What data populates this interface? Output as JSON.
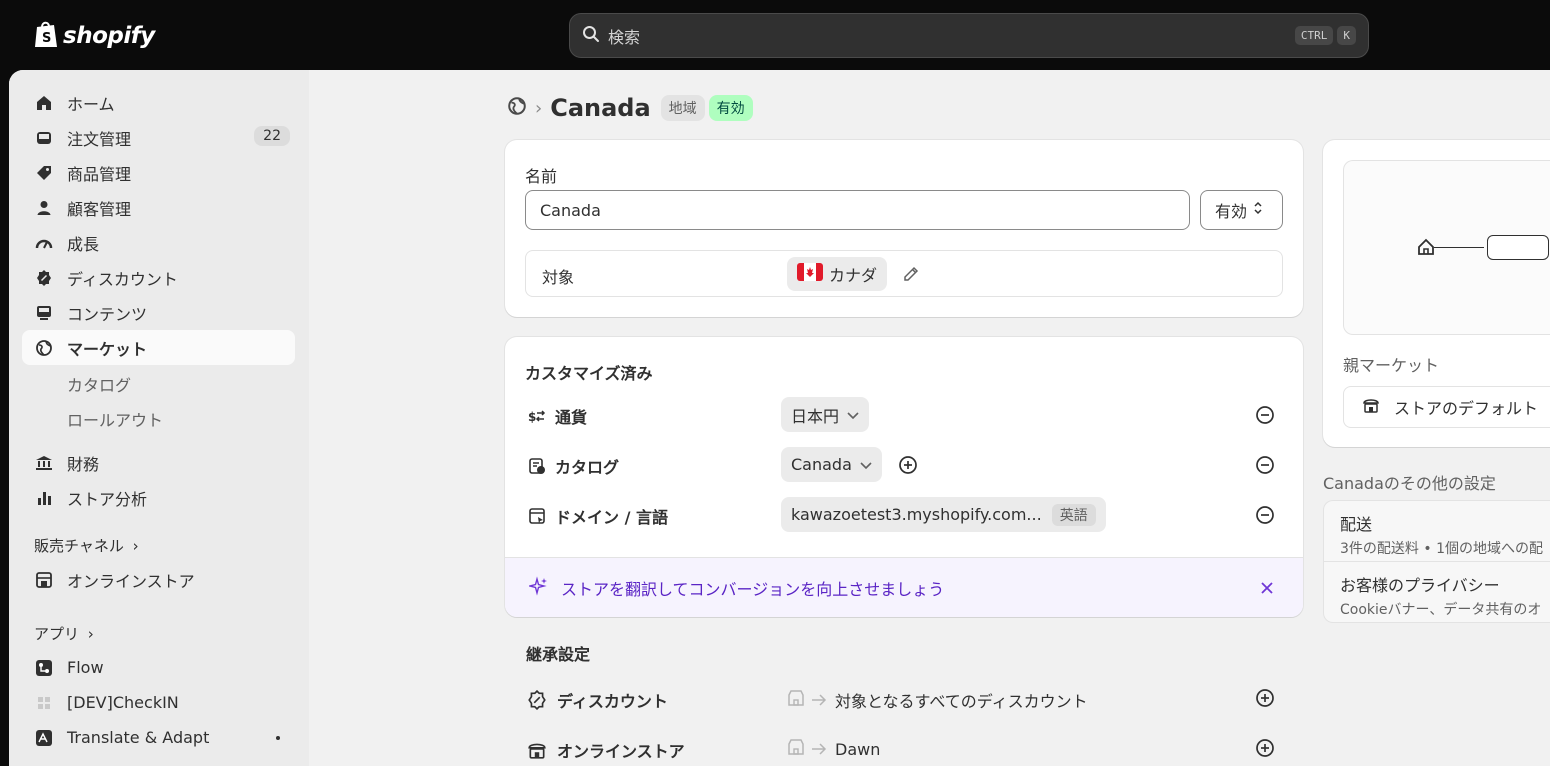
{
  "topbar": {
    "logo_text": "shopify",
    "search_placeholder": "検索",
    "kbd_ctrl": "CTRL",
    "kbd_k": "K"
  },
  "sidebar": {
    "items": [
      {
        "label": "ホーム",
        "icon": "home-icon"
      },
      {
        "label": "注文管理",
        "icon": "inbox-icon",
        "badge": "22"
      },
      {
        "label": "商品管理",
        "icon": "tag-icon"
      },
      {
        "label": "顧客管理",
        "icon": "person-icon"
      },
      {
        "label": "成長",
        "icon": "gauge-icon"
      },
      {
        "label": "ディスカウント",
        "icon": "discount-icon"
      },
      {
        "label": "コンテンツ",
        "icon": "content-icon"
      },
      {
        "label": "マーケット",
        "icon": "globe-icon"
      }
    ],
    "market_sub": [
      "カタログ",
      "ロールアウト"
    ],
    "items2": [
      {
        "label": "財務",
        "icon": "bank-icon"
      },
      {
        "label": "ストア分析",
        "icon": "bar-chart-icon"
      }
    ],
    "sales_channels_label": "販売チャネル",
    "online_store": "オンラインストア",
    "apps_label": "アプリ",
    "apps": [
      "Flow",
      "[DEV]CheckIN",
      "Translate & Adapt"
    ]
  },
  "page": {
    "title": "Canada",
    "badge_region": "地域",
    "badge_active": "有効"
  },
  "name_card": {
    "name_label": "名前",
    "name_value": "Canada",
    "status_select": "有効",
    "target_label": "対象",
    "target_country": "カナダ"
  },
  "custom_card": {
    "heading": "カスタマイズ済み",
    "rows": [
      {
        "label": "通貨",
        "value": "日本円"
      },
      {
        "label": "カタログ",
        "value": "Canada"
      },
      {
        "label": "ドメイン / 言語",
        "value": "kawazoetest3.myshopify.com...",
        "tag": "英語"
      }
    ],
    "banner": "ストアを翻訳してコンバージョンを向上させましょう"
  },
  "inherited": {
    "heading": "継承設定",
    "rows": [
      {
        "label": "ディスカウント",
        "value": "対象となるすべてのディスカウント"
      },
      {
        "label": "オンラインストア",
        "value": "Dawn"
      }
    ]
  },
  "right": {
    "parent_market_label": "親マーケット",
    "parent_market_value": "ストアのデフォルト",
    "other_settings_title": "Canadaのその他の設定",
    "settings": [
      {
        "title": "配送",
        "desc": "3件の配送料 • 1個の地域への配"
      },
      {
        "title": "お客様のプライバシー",
        "desc": "Cookieバナー、データ共有のオ"
      }
    ]
  }
}
